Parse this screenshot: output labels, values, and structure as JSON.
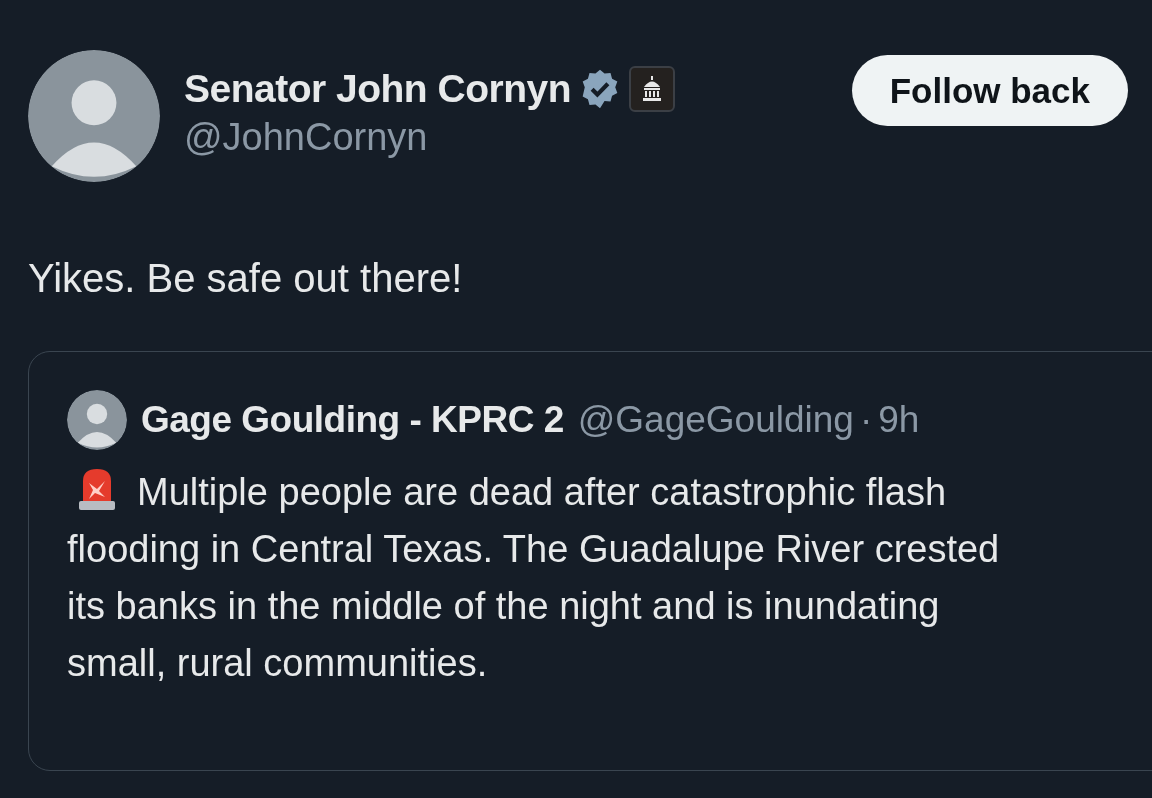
{
  "author": {
    "name": "Senator John Cornyn",
    "handle": "@JohnCornyn",
    "verified": true,
    "government_badge": true
  },
  "follow_button": {
    "label": "Follow back"
  },
  "text": "Yikes. Be safe out there!",
  "quoted_post": {
    "name": "Gage Goulding - KPRC 2",
    "handle": "@GageGoulding",
    "separator": "·",
    "time": "9h",
    "text": "Multiple people are dead after catastrophic flash flooding in Central Texas. The Guadalupe River crested its banks in the middle of the night and is inundating small, rural communities."
  }
}
